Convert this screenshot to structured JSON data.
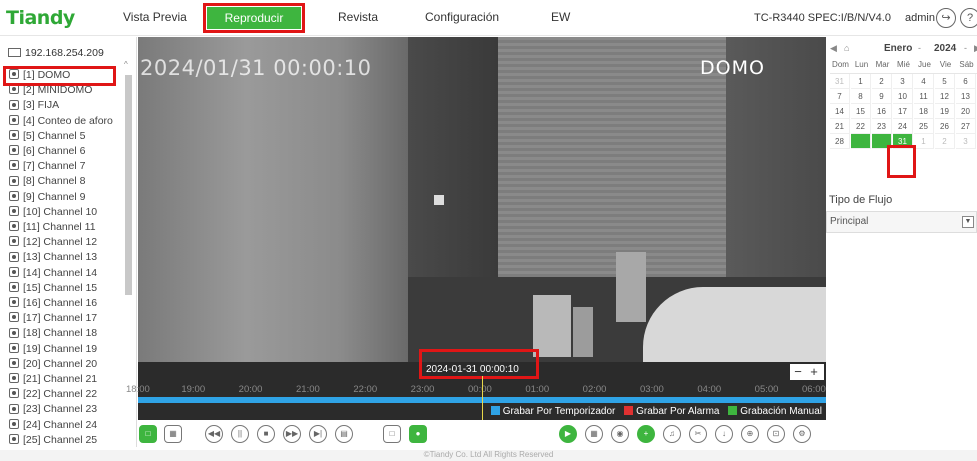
{
  "header": {
    "logo": "Tiandy",
    "nav": [
      "Vista Previa",
      "Reproducir",
      "Revista",
      "Configuración",
      "EW"
    ],
    "active_nav": "Reproducir",
    "device_info": "TC-R3440 SPEC:I/B/N/V4.0",
    "user": "admin",
    "logout_icon": "logout-icon",
    "help_icon": "help-icon"
  },
  "left_panel": {
    "device_ip": "192.168.254.209",
    "channels": [
      "[1] DOMO",
      "[2] MINIDOMO",
      "[3] FIJA",
      "[4] Conteo de aforo",
      "[5] Channel 5",
      "[6] Channel 6",
      "[7] Channel 7",
      "[8] Channel 8",
      "[9] Channel 9",
      "[10] Channel 10",
      "[11] Channel 11",
      "[12] Channel 12",
      "[13] Channel 13",
      "[14] Channel 14",
      "[15] Channel 15",
      "[16] Channel 16",
      "[17] Channel 17",
      "[18] Channel 18",
      "[19] Channel 19",
      "[20] Channel 20",
      "[21] Channel 21",
      "[22] Channel 22",
      "[23] Channel 23",
      "[24] Channel 24",
      "[25] Channel 25"
    ],
    "selected_channel": "[1] DOMO"
  },
  "video": {
    "osd_time": "2024/01/31 00:00:10",
    "osd_name": "DOMO"
  },
  "timeline": {
    "current_datetime": "2024-01-31 00:00:10",
    "labels": [
      "18:00",
      "19:00",
      "20:00",
      "21:00",
      "22:00",
      "23:00",
      "00:00",
      "01:00",
      "02:00",
      "03:00",
      "04:00",
      "05:00",
      "06:00"
    ],
    "zoom_out": "−",
    "zoom_in": "+",
    "legend": [
      {
        "label": "Grabar Por Temporizador",
        "color": "#2fa3e6"
      },
      {
        "label": "Grabar Por Alarma",
        "color": "#e03131"
      },
      {
        "label": "Grabación Manual",
        "color": "#3eb53f"
      }
    ]
  },
  "controls": {
    "left_buttons": [
      "single-view-icon",
      "grid-view-icon",
      "rewind-icon",
      "pause-icon",
      "stop-icon",
      "fast-forward-icon",
      "step-icon",
      "folder-icon",
      "window-icon",
      "record-icon"
    ],
    "right_buttons": [
      "play-sync-icon",
      "film-icon",
      "camera-icon",
      "zoom-icon",
      "audio-icon",
      "clip-icon",
      "download-icon",
      "magnify-icon",
      "crop-icon",
      "settings-icon"
    ]
  },
  "footer": "©Tiandy Co. Ltd All Rights Reserved",
  "calendar": {
    "month": "Enero",
    "year": "2024",
    "weekdays": [
      "Dom",
      "Lun",
      "Mar",
      "Mié",
      "Jue",
      "Vie",
      "Sáb"
    ],
    "weeks": [
      [
        "31",
        "1",
        "2",
        "3",
        "4",
        "5",
        "6"
      ],
      [
        "7",
        "8",
        "9",
        "10",
        "11",
        "12",
        "13"
      ],
      [
        "14",
        "15",
        "16",
        "17",
        "18",
        "19",
        "20"
      ],
      [
        "21",
        "22",
        "23",
        "24",
        "25",
        "26",
        "27"
      ],
      [
        "28",
        "29",
        "30",
        "31",
        "1",
        "2",
        "3"
      ]
    ],
    "recorded_days": [
      "29",
      "30"
    ],
    "selected_day": "31",
    "accent": "#3eb53f"
  },
  "stream": {
    "label": "Tipo de Flujo",
    "value": "Principal"
  }
}
